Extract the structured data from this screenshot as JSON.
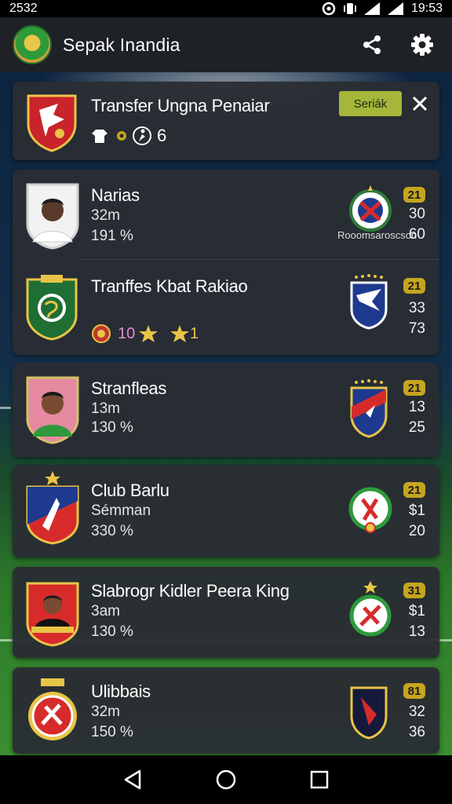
{
  "status_bar": {
    "time_left": "2532",
    "time_right": "19:53"
  },
  "app_bar": {
    "title": "Sepak Inandia"
  },
  "transfer_card": {
    "title": "Transfer Ungna Penaiar",
    "button_label": "Seriák",
    "info_value": "6"
  },
  "rows": [
    {
      "name": "Narias",
      "line1": "32m",
      "line2": "191 %",
      "club_caption": "Rooomsaroscson",
      "badge": "21",
      "stat1": "30",
      "stat2": "60"
    },
    {
      "name": "Tranffes Kbat Rakiao",
      "rating_value": "10",
      "rating_end": "1",
      "badge": "21",
      "stat1": "33",
      "stat2": "73"
    },
    {
      "name": "Stranfleas",
      "line1": "13m",
      "line2": "130 %",
      "badge": "21",
      "stat1": "13",
      "stat2": "25"
    },
    {
      "name": "Club Barlu",
      "line1": "Sémman",
      "line2": "330 %",
      "badge": "21",
      "stat1": "$1",
      "stat2": "20"
    },
    {
      "name": "Slabrogr Kidler Peera King",
      "line1": "3am",
      "line2": "130 %",
      "badge": "31",
      "stat1": "$1",
      "stat2": "13"
    },
    {
      "name": "Ulibbais",
      "line1": "32m",
      "line2": "150 %",
      "badge": "81",
      "stat1": "32",
      "stat2": "36"
    }
  ],
  "colors": {
    "accent_button": "#a6b63a",
    "badge": "#c6a51f",
    "card": "#2a2d33",
    "app_bar": "#1e2126"
  }
}
